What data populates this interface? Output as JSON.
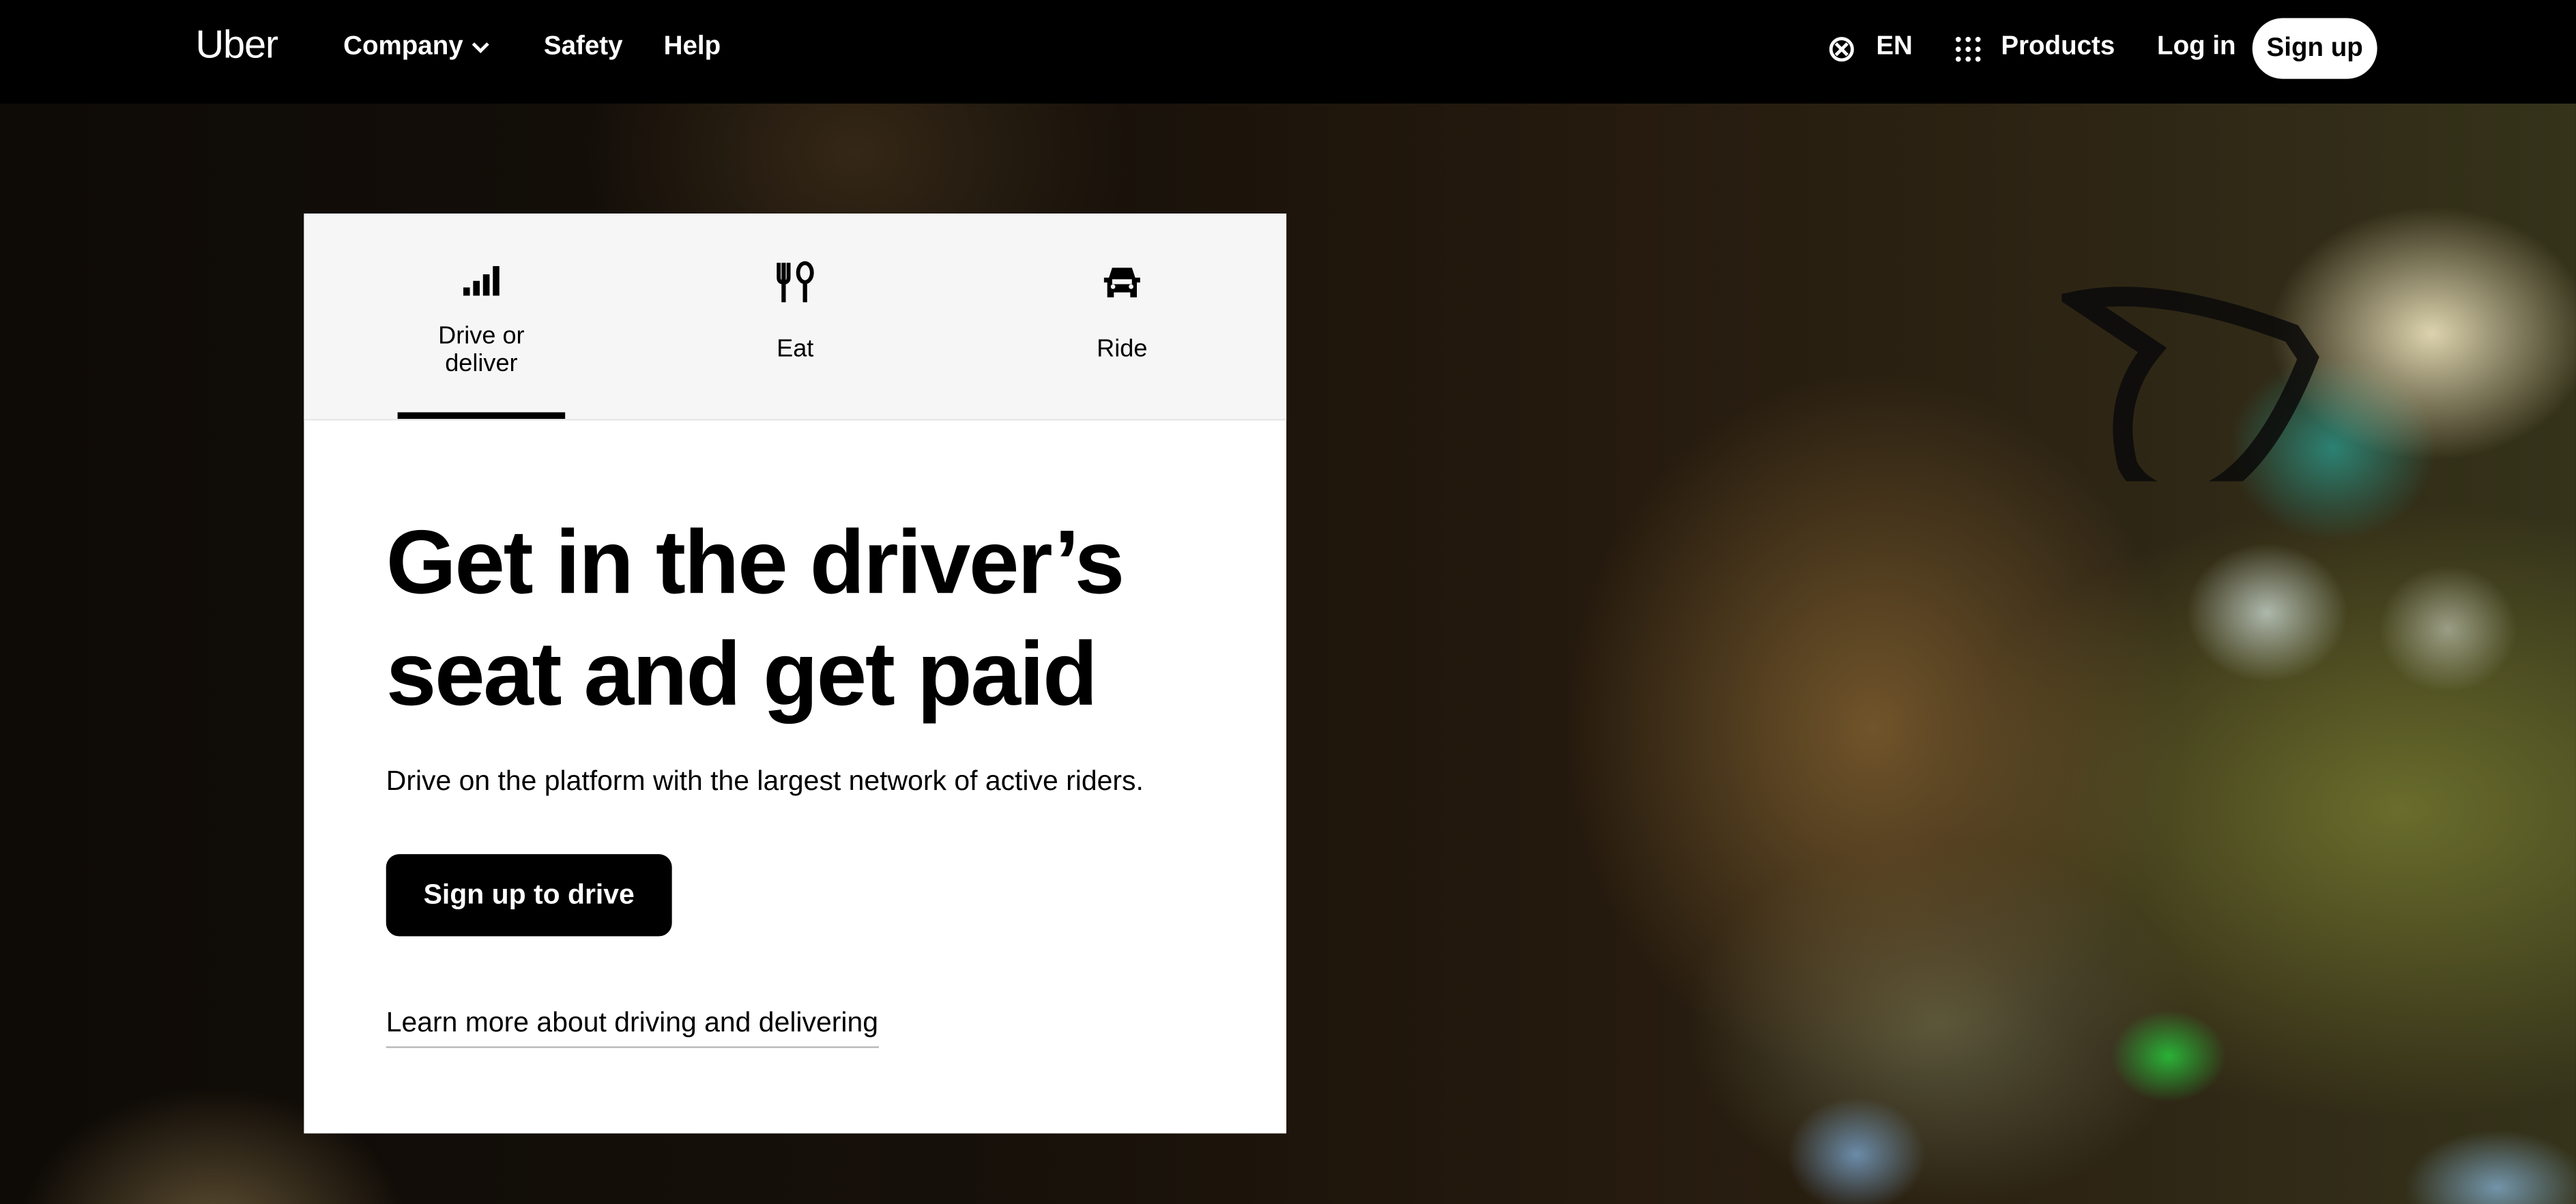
{
  "navbar": {
    "logo": "Uber",
    "company_label": "Company",
    "safety_label": "Safety",
    "help_label": "Help",
    "language_label": "EN",
    "products_label": "Products",
    "login_label": "Log in",
    "signup_label": "Sign up",
    "icons": [
      "chevron-down-icon",
      "globe-icon",
      "grid-icon"
    ]
  },
  "card": {
    "tabs": [
      {
        "label": "Drive or deliver",
        "icon": "signal-bars-icon",
        "selected": true
      },
      {
        "label": "Eat",
        "icon": "fork-spoon-icon",
        "selected": false
      },
      {
        "label": "Ride",
        "icon": "car-icon",
        "selected": false
      }
    ],
    "headline": "Get in the driver’s seat and get paid",
    "subtext": "Drive on the platform with the largest network of active riders.",
    "cta_label": "Sign up to drive",
    "learn_more_label": "Learn more about driving and delivering"
  },
  "colors": {
    "navbar_bg": "#000000",
    "card_bg": "#ffffff",
    "tabs_bg": "#f6f6f6",
    "primary_button": "#000000"
  }
}
